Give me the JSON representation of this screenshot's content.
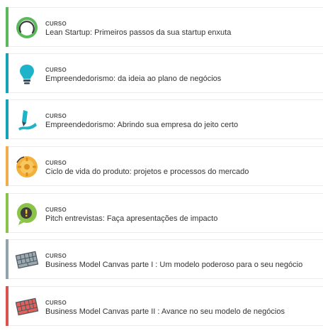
{
  "courses": [
    {
      "kind": "CURSO",
      "title": "Lean Startup: Primeiros passos da sua startup enxuta",
      "accent": "#5cb85c",
      "icon": "lean-startup-icon"
    },
    {
      "kind": "CURSO",
      "title": "Empreendedorismo: da ideia ao plano de negócios",
      "accent": "#17a2b8",
      "icon": "lightbulb-icon"
    },
    {
      "kind": "CURSO",
      "title": "Empreendedorismo: Abrindo sua empresa do jeito certo",
      "accent": "#17a2b8",
      "icon": "pen-icon"
    },
    {
      "kind": "CURSO",
      "title": "Ciclo de vida do produto: projetos e processos do mercado",
      "accent": "#f0ad4e",
      "icon": "gear-icon"
    },
    {
      "kind": "CURSO",
      "title": "Pitch entrevistas: Faça apresentações de impacto",
      "accent": "#8bc34a",
      "icon": "speech-icon"
    },
    {
      "kind": "CURSO",
      "title": "Business Model Canvas parte I : Um modelo poderoso para o seu negócio",
      "accent": "#90a4ae",
      "icon": "canvas-icon"
    },
    {
      "kind": "CURSO",
      "title": "Business Model Canvas parte II : Avance no seu modelo de negócios",
      "accent": "#d9534f",
      "icon": "canvas-icon"
    }
  ]
}
